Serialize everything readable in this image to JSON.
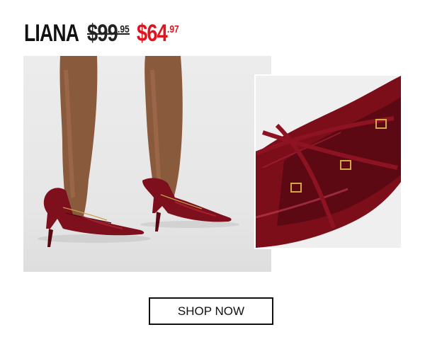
{
  "product": {
    "name": "LIANA",
    "original_price": {
      "dollars": "$99",
      "cents": ".95"
    },
    "sale_price": {
      "dollars": "$64",
      "cents": ".97"
    }
  },
  "images": {
    "main": "model-wearing-red-patent-slingback-pumps",
    "detail": "closeup-red-patent-strappy-buckles"
  },
  "cta": {
    "label": "SHOP NOW"
  },
  "colors": {
    "sale": "#e0141e",
    "shoe": "#8a1220",
    "text": "#111111"
  }
}
